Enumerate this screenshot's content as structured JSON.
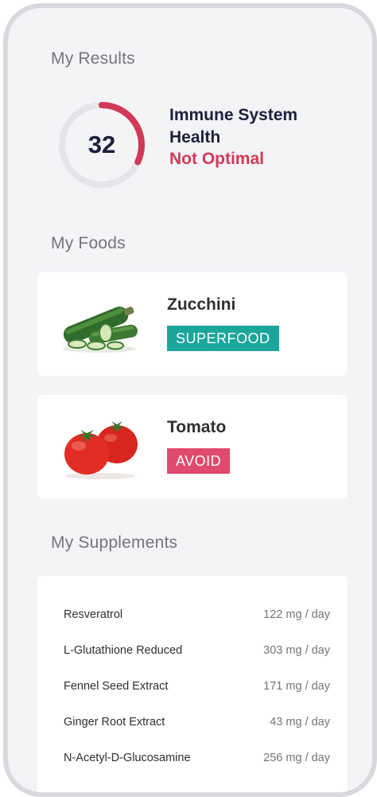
{
  "results": {
    "section_title": "My Results",
    "score": "32",
    "score_fraction": 0.32,
    "metric_name": "Immune System Health",
    "status": "Not Optimal",
    "colors": {
      "ring_track": "#e4e5e9",
      "ring_fill": "#d13a56",
      "status": "#d13a56"
    }
  },
  "foods": {
    "section_title": "My Foods",
    "items": [
      {
        "name": "Zucchini",
        "badge": "SUPERFOOD",
        "badge_color": "#1ba69b",
        "image": "zucchini-image"
      },
      {
        "name": "Tomato",
        "badge": "AVOID",
        "badge_color": "#e04a6d",
        "image": "tomato-image"
      }
    ]
  },
  "supplements": {
    "section_title": "My Supplements",
    "items": [
      {
        "name": "Resveratrol",
        "dose": "122 mg / day"
      },
      {
        "name": "L-Glutathione Reduced",
        "dose": "303 mg / day"
      },
      {
        "name": "Fennel Seed Extract",
        "dose": "171 mg / day"
      },
      {
        "name": "Ginger Root Extract",
        "dose": "43 mg / day"
      },
      {
        "name": "N-Acetyl-D-Glucosamine",
        "dose": "256 mg / day"
      }
    ]
  }
}
